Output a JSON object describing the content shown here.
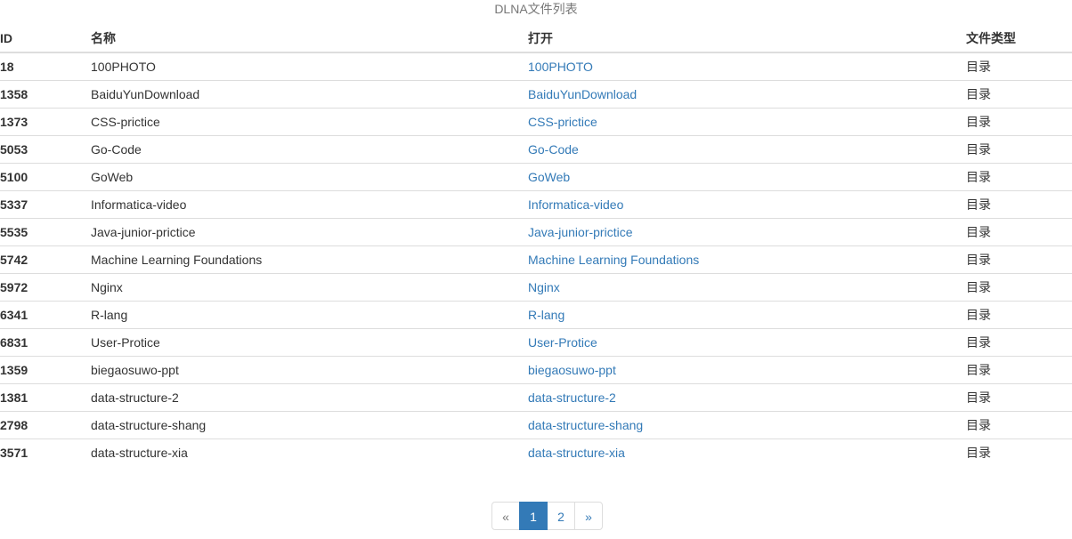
{
  "caption": "DLNA文件列表",
  "headers": {
    "id": "ID",
    "name": "名称",
    "open": "打开",
    "type": "文件类型"
  },
  "rows": [
    {
      "id": "18",
      "name": "100PHOTO",
      "open": "100PHOTO",
      "type": "目录"
    },
    {
      "id": "1358",
      "name": "BaiduYunDownload",
      "open": "BaiduYunDownload",
      "type": "目录"
    },
    {
      "id": "1373",
      "name": "CSS-prictice",
      "open": "CSS-prictice",
      "type": "目录"
    },
    {
      "id": "5053",
      "name": "Go-Code",
      "open": "Go-Code",
      "type": "目录"
    },
    {
      "id": "5100",
      "name": "GoWeb",
      "open": "GoWeb",
      "type": "目录"
    },
    {
      "id": "5337",
      "name": "Informatica-video",
      "open": "Informatica-video",
      "type": "目录"
    },
    {
      "id": "5535",
      "name": "Java-junior-prictice",
      "open": "Java-junior-prictice",
      "type": "目录"
    },
    {
      "id": "5742",
      "name": "Machine Learning Foundations",
      "open": "Machine Learning Foundations",
      "type": "目录"
    },
    {
      "id": "5972",
      "name": "Nginx",
      "open": "Nginx",
      "type": "目录"
    },
    {
      "id": "6341",
      "name": "R-lang",
      "open": "R-lang",
      "type": "目录"
    },
    {
      "id": "6831",
      "name": "User-Protice",
      "open": "User-Protice",
      "type": "目录"
    },
    {
      "id": "1359",
      "name": "biegaosuwo-ppt",
      "open": "biegaosuwo-ppt",
      "type": "目录"
    },
    {
      "id": "1381",
      "name": "data-structure-2",
      "open": "data-structure-2",
      "type": "目录"
    },
    {
      "id": "2798",
      "name": "data-structure-shang",
      "open": "data-structure-shang",
      "type": "目录"
    },
    {
      "id": "3571",
      "name": "data-structure-xia",
      "open": "data-structure-xia",
      "type": "目录"
    }
  ],
  "pagination": {
    "prev": "«",
    "pages": [
      "1",
      "2"
    ],
    "current": "1",
    "next": "»"
  },
  "colors": {
    "link": "#337ab7",
    "active_page_bg": "#337ab7",
    "border": "#dddddd",
    "caption": "#777777"
  }
}
